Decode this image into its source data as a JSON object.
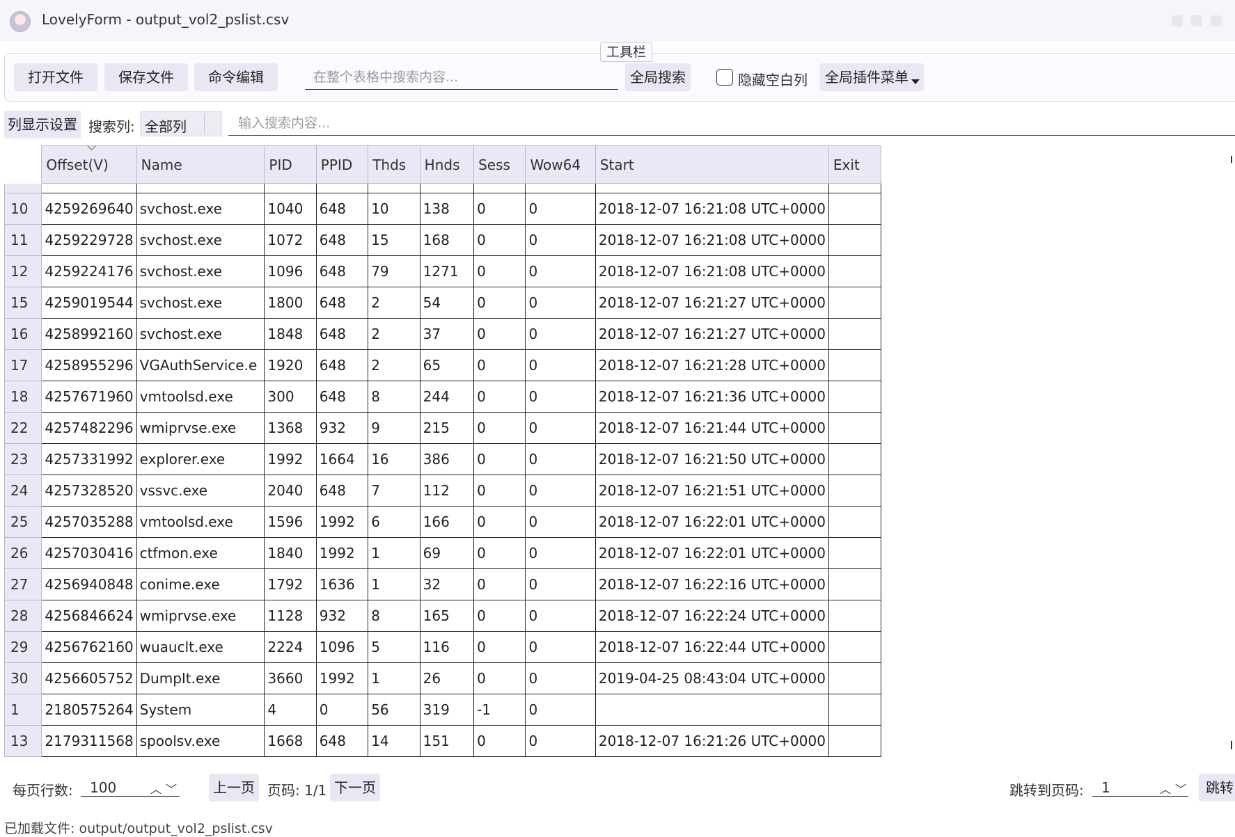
{
  "window": {
    "title": "LovelyForm - output_vol2_pslist.csv"
  },
  "toolbar": {
    "caption": "工具栏",
    "open_file": "打开文件",
    "save_file": "保存文件",
    "command_edit": "命令编辑",
    "global_search_placeholder": "在整个表格中搜索内容...",
    "global_search_button": "全局搜索",
    "hide_empty_columns_label": "隐藏空白列",
    "hide_empty_columns_checked": false,
    "plugin_menu": "全局插件菜单"
  },
  "filter_bar": {
    "column_display_settings": "列显示设置",
    "search_column_label": "搜索列:",
    "search_column_value": "全部列",
    "search_input_placeholder": "输入搜索内容..."
  },
  "table": {
    "columns": [
      "Offset(V)",
      "Name",
      "PID",
      "PPID",
      "Thds",
      "Hnds",
      "Sess",
      "Wow64",
      "Start",
      "Exit"
    ],
    "rows": [
      {
        "row": "10",
        "cells": [
          "4259269640",
          "svchost.exe",
          "1040",
          "648",
          "10",
          "138",
          "0",
          "0",
          "2018-12-07 16:21:08 UTC+0000",
          ""
        ]
      },
      {
        "row": "11",
        "cells": [
          "4259229728",
          "svchost.exe",
          "1072",
          "648",
          "15",
          "168",
          "0",
          "0",
          "2018-12-07 16:21:08 UTC+0000",
          ""
        ]
      },
      {
        "row": "12",
        "cells": [
          "4259224176",
          "svchost.exe",
          "1096",
          "648",
          "79",
          "1271",
          "0",
          "0",
          "2018-12-07 16:21:08 UTC+0000",
          ""
        ]
      },
      {
        "row": "15",
        "cells": [
          "4259019544",
          "svchost.exe",
          "1800",
          "648",
          "2",
          "54",
          "0",
          "0",
          "2018-12-07 16:21:27 UTC+0000",
          ""
        ]
      },
      {
        "row": "16",
        "cells": [
          "4258992160",
          "svchost.exe",
          "1848",
          "648",
          "2",
          "37",
          "0",
          "0",
          "2018-12-07 16:21:27 UTC+0000",
          ""
        ]
      },
      {
        "row": "17",
        "cells": [
          "4258955296",
          "VGAuthService.e",
          "1920",
          "648",
          "2",
          "65",
          "0",
          "0",
          "2018-12-07 16:21:28 UTC+0000",
          ""
        ]
      },
      {
        "row": "18",
        "cells": [
          "4257671960",
          "vmtoolsd.exe",
          "300",
          "648",
          "8",
          "244",
          "0",
          "0",
          "2018-12-07 16:21:36 UTC+0000",
          ""
        ]
      },
      {
        "row": "22",
        "cells": [
          "4257482296",
          "wmiprvse.exe",
          "1368",
          "932",
          "9",
          "215",
          "0",
          "0",
          "2018-12-07 16:21:44 UTC+0000",
          ""
        ]
      },
      {
        "row": "23",
        "cells": [
          "4257331992",
          "explorer.exe",
          "1992",
          "1664",
          "16",
          "386",
          "0",
          "0",
          "2018-12-07 16:21:50 UTC+0000",
          ""
        ]
      },
      {
        "row": "24",
        "cells": [
          "4257328520",
          "vssvc.exe",
          "2040",
          "648",
          "7",
          "112",
          "0",
          "0",
          "2018-12-07 16:21:51 UTC+0000",
          ""
        ]
      },
      {
        "row": "25",
        "cells": [
          "4257035288",
          "vmtoolsd.exe",
          "1596",
          "1992",
          "6",
          "166",
          "0",
          "0",
          "2018-12-07 16:22:01 UTC+0000",
          ""
        ]
      },
      {
        "row": "26",
        "cells": [
          "4257030416",
          "ctfmon.exe",
          "1840",
          "1992",
          "1",
          "69",
          "0",
          "0",
          "2018-12-07 16:22:01 UTC+0000",
          ""
        ]
      },
      {
        "row": "27",
        "cells": [
          "4256940848",
          "conime.exe",
          "1792",
          "1636",
          "1",
          "32",
          "0",
          "0",
          "2018-12-07 16:22:16 UTC+0000",
          ""
        ]
      },
      {
        "row": "28",
        "cells": [
          "4256846624",
          "wmiprvse.exe",
          "1128",
          "932",
          "8",
          "165",
          "0",
          "0",
          "2018-12-07 16:22:24 UTC+0000",
          ""
        ]
      },
      {
        "row": "29",
        "cells": [
          "4256762160",
          "wuauclt.exe",
          "2224",
          "1096",
          "5",
          "116",
          "0",
          "0",
          "2018-12-07 16:22:44 UTC+0000",
          ""
        ]
      },
      {
        "row": "30",
        "cells": [
          "4256605752",
          "DumpIt.exe",
          "3660",
          "1992",
          "1",
          "26",
          "0",
          "0",
          "2019-04-25 08:43:04 UTC+0000",
          ""
        ]
      },
      {
        "row": "1",
        "cells": [
          "2180575264",
          "System",
          "4",
          "0",
          "56",
          "319",
          "-1",
          "0",
          "",
          ""
        ]
      },
      {
        "row": "13",
        "cells": [
          "2179311568",
          "spoolsv.exe",
          "1668",
          "648",
          "14",
          "151",
          "0",
          "0",
          "2018-12-07 16:21:26 UTC+0000",
          ""
        ]
      }
    ]
  },
  "pagination": {
    "rows_per_page_label": "每页行数:",
    "rows_per_page_value": "100",
    "prev_page": "上一页",
    "page_indicator": "页码: 1/1",
    "next_page": "下一页",
    "jump_label": "跳转到页码:",
    "jump_value": "1",
    "jump_button": "跳转"
  },
  "status_bar": {
    "text": "已加载文件: output/output_vol2_pslist.csv"
  },
  "colors": {
    "header_bg": "#e8e8f6",
    "button_bg": "#e8e8f4",
    "grid_line": "#222222"
  }
}
